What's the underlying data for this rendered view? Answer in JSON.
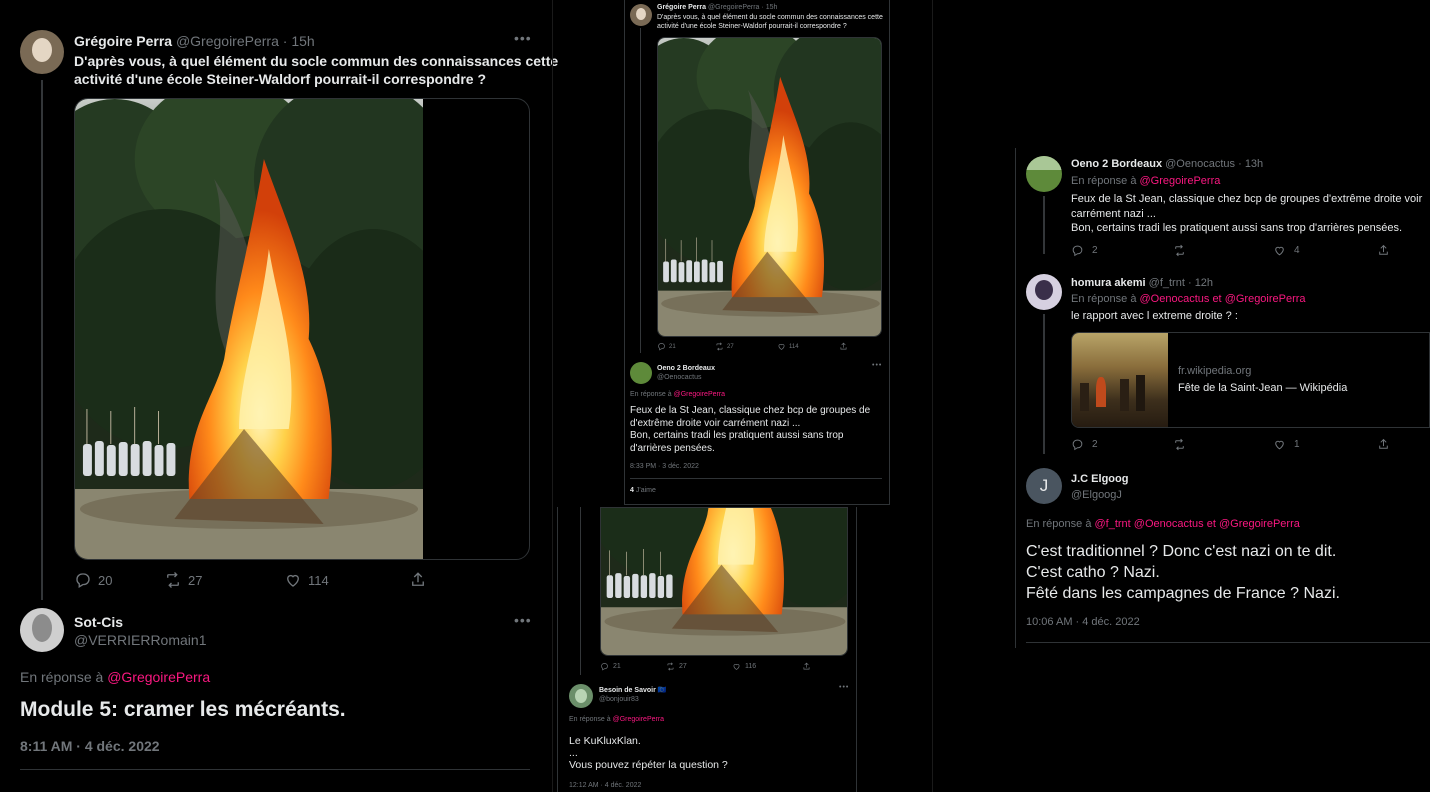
{
  "colors": {
    "background": "#000000",
    "accent": "#f91880",
    "muted": "#71767b",
    "text": "#e7e9ea"
  },
  "left": {
    "tweet1": {
      "name": "Grégoire Perra",
      "handle": "@GregoirePerra",
      "time": "15h",
      "text_line1": "D'après vous, à quel élément du socle commun des connaissances cette",
      "text_line2": "activité d'une école Steiner-Waldorf pourrait-il correspondre ?",
      "replies": "20",
      "retweets": "27",
      "likes": "114"
    },
    "tweet2": {
      "name": "Sot-Cis",
      "handle": "@VERRIERRomain1",
      "reply_prefix": "En réponse à",
      "reply_to": "@GregoirePerra",
      "text": "Module 5: cramer les mécréants.",
      "timestamp": "8:11 AM · 4 déc. 2022"
    }
  },
  "middle_top": {
    "tweet1": {
      "name": "Grégoire Perra",
      "handle": "@GregoirePerra",
      "time": "15h",
      "text_line1": "D'après vous, à quel élément du socle commun des connaissances cette",
      "text_line2": "activité d'une école Steiner-Waldorf pourrait-il correspondre ?",
      "replies": "21",
      "retweets": "27",
      "likes": "114"
    },
    "tweet2": {
      "name": "Oeno 2 Bordeaux",
      "handle": "@Oenocactus",
      "reply_prefix": "En réponse à",
      "reply_to": "@GregoirePerra",
      "text_line1": "Feux de la St Jean, classique chez bcp de groupes de",
      "text_line2": "d'extrême droite voir carrément nazi ...",
      "text_line3": "Bon, certains tradi les pratiquent aussi sans trop",
      "text_line4": "d'arrières pensées.",
      "timestamp": "8:33 PM · 3 déc. 2022",
      "likes_count": "4",
      "likes_label": "J'aime"
    }
  },
  "middle_bottom": {
    "tweet1": {
      "replies": "21",
      "retweets": "27",
      "likes": "116"
    },
    "tweet2": {
      "name": "Besoin de Savoir",
      "badge": "🇪🇺",
      "handle": "@bonjouir83",
      "reply_prefix": "En réponse à",
      "reply_to": "@GregoirePerra",
      "text_line1": "Le KuKluxKlan.",
      "text_line2": "...",
      "text_line3": "Vous pouvez répéter la question ?",
      "timestamp": "12:12 AM · 4 déc. 2022"
    }
  },
  "right": {
    "tweet1": {
      "name": "Oeno 2 Bordeaux",
      "handle": "@Oenocactus",
      "time": "13h",
      "reply_prefix": "En réponse à",
      "reply_to": "@GregoirePerra",
      "text_line1": "Feux de la St Jean, classique chez bcp de groupes d'extrême droite voir",
      "text_line2": "carrément nazi ...",
      "text_line3": "Bon, certains tradi les pratiquent aussi sans trop d'arrières pensées.",
      "replies": "2",
      "retweets": "",
      "likes": "4"
    },
    "tweet2": {
      "name": "homura akemi",
      "handle": "@f_trnt",
      "time": "12h",
      "reply_prefix": "En réponse à",
      "reply_to_1": "@Oenocactus",
      "reply_and": "et",
      "reply_to_2": "@GregoirePerra",
      "text": "le rapport avec l extreme droite ? :",
      "card_domain": "fr.wikipedia.org",
      "card_title": "Fête de la Saint-Jean — Wikipédia",
      "replies": "2",
      "retweets": "",
      "likes": "1"
    },
    "tweet3": {
      "name": "J.C Elgoog",
      "handle": "@ElgoogJ",
      "avatar_letter": "J",
      "reply_prefix": "En réponse à",
      "reply_to_1": "@f_trnt",
      "reply_to_2": "@Oenocactus",
      "reply_and": "et",
      "reply_to_3": "@GregoirePerra",
      "text_line1": "C'est traditionnel ? Donc c'est nazi on  te dit.",
      "text_line2": "C'est catho ? Nazi.",
      "text_line3": "Fêté dans les campagnes de France ? Nazi.",
      "timestamp": "10:06 AM · 4 déc. 2022"
    }
  }
}
